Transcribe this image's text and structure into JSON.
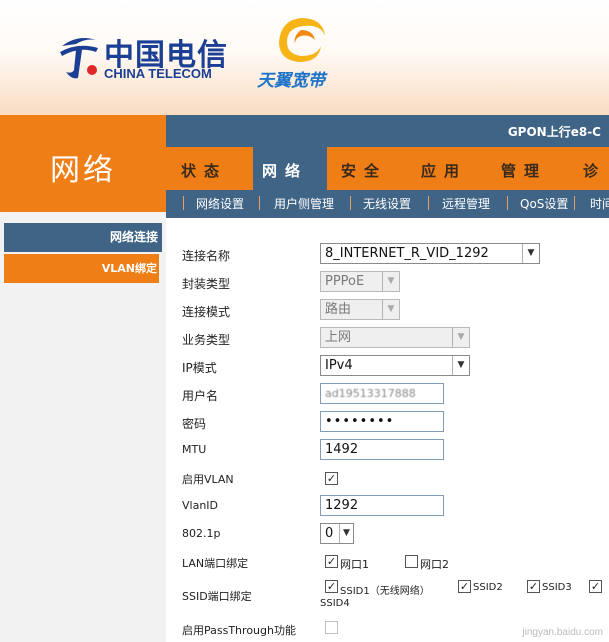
{
  "header": {
    "brand_cn": "中国电信",
    "brand_en": "CHINA TELECOM",
    "tianyi": "天翼宽带",
    "device": "GPON上行e8-C"
  },
  "sidebar": {
    "title": "网络",
    "items": [
      {
        "label": "网络连接",
        "active": true
      },
      {
        "label": "VLAN绑定",
        "active": false
      }
    ]
  },
  "tabs": [
    "状态",
    "网络",
    "安全",
    "应用",
    "管理",
    "诊"
  ],
  "active_tab": "网络",
  "subtabs": [
    "网络设置",
    "用户侧管理",
    "无线设置",
    "远程管理",
    "QoS设置",
    "时间"
  ],
  "form": {
    "conn_name": {
      "label": "连接名称",
      "value": "8_INTERNET_R_VID_1292"
    },
    "encap": {
      "label": "封装类型",
      "value": "PPPoE"
    },
    "mode": {
      "label": "连接模式",
      "value": "路由"
    },
    "service": {
      "label": "业务类型",
      "value": "上网"
    },
    "ipmode": {
      "label": "IP模式",
      "value": "IPv4"
    },
    "username": {
      "label": "用户名",
      "value": "ad19513317888"
    },
    "password": {
      "label": "密码",
      "value": "••••••••"
    },
    "mtu": {
      "label": "MTU",
      "value": "1492"
    },
    "vlan_enable": {
      "label": "启用VLAN",
      "checked": true
    },
    "vlanid": {
      "label": "VlanID",
      "value": "1292"
    },
    "p8021": {
      "label": "802.1p",
      "value": "0"
    },
    "lan_bind": {
      "label": "LAN端口绑定",
      "opts": [
        "网口1",
        "网口2"
      ],
      "checked": [
        true,
        false
      ]
    },
    "ssid_bind": {
      "label": "SSID端口绑定",
      "opts": [
        "SSID1（无线网络）",
        "SSID2",
        "SSID3",
        "SSID4"
      ],
      "checked": [
        true,
        true,
        true,
        true
      ]
    },
    "passthrough": {
      "label": "启用PassThrough功能",
      "checked": false
    }
  },
  "watermark": "jingyan.baidu.com",
  "colors": {
    "orange": "#ef7e17",
    "steel": "#3f6485",
    "brand_blue": "#1b3f94"
  }
}
